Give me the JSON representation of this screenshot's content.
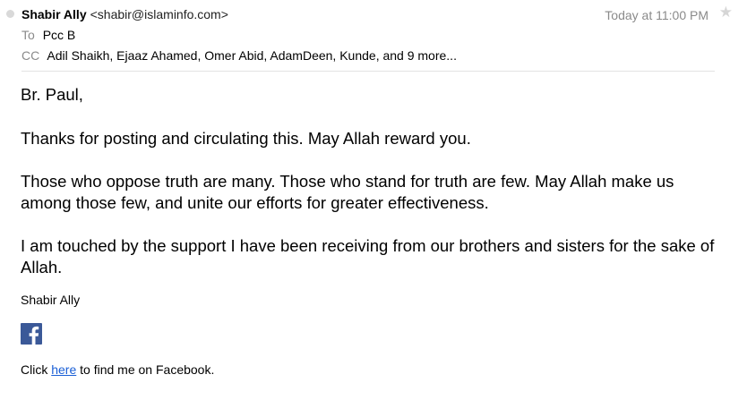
{
  "header": {
    "from_name": "Shabir Ally",
    "from_email": "<shabir@islaminfo.com>",
    "date": "Today at 11:00 PM",
    "star_icon": "star-icon",
    "to_label": "To",
    "to_value": "Pcc B",
    "cc_label": "CC",
    "cc_value": "Adil Shaikh, Ejaaz Ahamed, Omer Abid, AdamDeen, Kunde, and 9 more..."
  },
  "body": {
    "greeting": "Br. Paul,",
    "paragraphs": [
      "Thanks for posting and circulating this. May Allah reward you.",
      "Those who oppose truth are many. Those who stand for truth are few. May Allah make us among those few, and unite our efforts for greater effectiveness.",
      "I am touched by the support I have been receiving from our brothers and sisters for the sake of Allah."
    ]
  },
  "signature": {
    "name": "Shabir Ally",
    "facebook_icon": "facebook-icon",
    "click_prefix": "Click",
    "link_text": "here",
    "click_suffix": "to find me on Facebook."
  },
  "colors": {
    "facebook_blue": "#3b5998",
    "link_blue": "#1a5fd6",
    "meta_gray": "#8a8a8a"
  }
}
